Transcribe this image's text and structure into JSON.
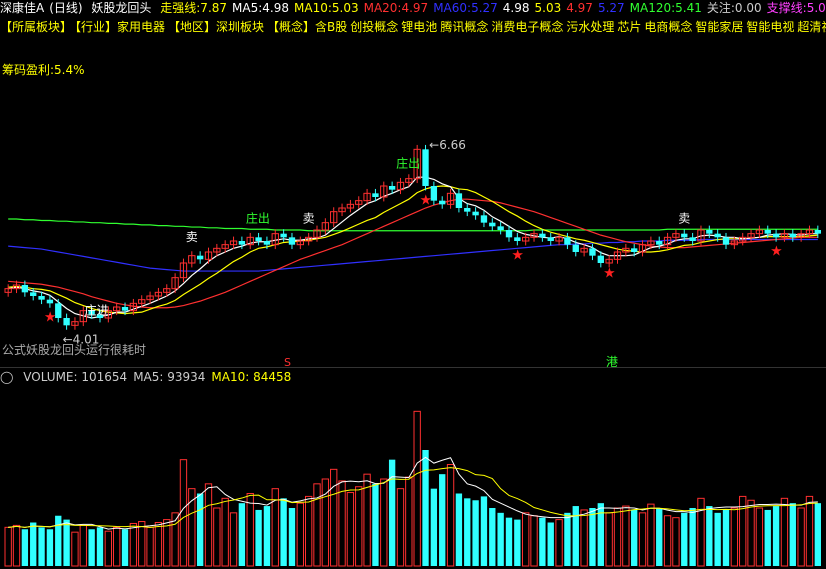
{
  "header": {
    "stock": "深康佳A",
    "period": "(日线)",
    "formula_name": "妖股龙回头",
    "indicators": [
      {
        "label": "走强线:",
        "value": "7.87",
        "color": "#ffff00"
      },
      {
        "label": "MA5:",
        "value": "4.98",
        "color": "#ffffff"
      },
      {
        "label": "MA10:",
        "value": "5.03",
        "color": "#ffff00"
      },
      {
        "label": "MA20:",
        "value": "4.97",
        "color": "#ff3030"
      },
      {
        "label": "MA60:",
        "value": "5.27",
        "color": "#3030ff"
      },
      {
        "label": "",
        "value": "4.98",
        "color": "#ffffff"
      },
      {
        "label": "",
        "value": "5.03",
        "color": "#ffff00"
      },
      {
        "label": "",
        "value": "4.97",
        "color": "#ff3030"
      },
      {
        "label": "",
        "value": "5.27",
        "color": "#3030ff"
      },
      {
        "label": "MA120:",
        "value": "5.41",
        "color": "#30ff30"
      },
      {
        "label": "关注:",
        "value": "0.00",
        "color": "#cccccc"
      },
      {
        "label": "支撑线:",
        "value": "5.0",
        "color": "#ff40ff"
      }
    ]
  },
  "tags": [
    "【所属板块】",
    "【行业】家用电器",
    "【地区】深圳板块",
    "【概念】含B股",
    "创投概念",
    "锂电池",
    "腾讯概念",
    "消费电子概念",
    "污水处理",
    "芯片",
    "电商概念",
    "智能家居",
    "智能电视",
    "超清视频"
  ],
  "chip_profit": "筹码盈利:5.4%",
  "formula_note": "公式妖股龙回头运行很耗时",
  "markers": {
    "high": "6.66",
    "low": "4.01",
    "sell": "卖",
    "zhuangchu": "庄出",
    "zhuangjin": "庄进",
    "s_mark": "S",
    "gang_mark": "港"
  },
  "volume_header": [
    {
      "label": "VOLUME:",
      "value": "101654",
      "color": "#cccccc"
    },
    {
      "label": "MA5:",
      "value": "93934",
      "color": "#cccccc"
    },
    {
      "label": "MA10:",
      "value": "84458",
      "color": "#ffff00"
    }
  ],
  "colors": {
    "up": "#ff3030",
    "down": "#30ffff",
    "ma5": "#ffffff",
    "ma10": "#ffff00",
    "ma20": "#ff3030",
    "ma60": "#3030ff",
    "ma120": "#30ff30",
    "support": "#ff40ff"
  },
  "chart_data": {
    "type": "candlestick",
    "price_range": [
      3.9,
      6.9
    ],
    "close": [
      4.6,
      4.65,
      4.55,
      4.5,
      4.45,
      4.4,
      4.2,
      4.1,
      4.15,
      4.3,
      4.25,
      4.2,
      4.3,
      4.35,
      4.3,
      4.4,
      4.45,
      4.5,
      4.55,
      4.6,
      4.75,
      4.95,
      5.05,
      5.0,
      5.1,
      5.15,
      5.2,
      5.25,
      5.2,
      5.3,
      5.25,
      5.2,
      5.35,
      5.3,
      5.2,
      5.25,
      5.3,
      5.4,
      5.5,
      5.65,
      5.7,
      5.75,
      5.8,
      5.9,
      5.85,
      6.0,
      5.95,
      6.05,
      6.1,
      6.5,
      6.0,
      5.8,
      5.75,
      5.9,
      5.7,
      5.65,
      5.6,
      5.5,
      5.45,
      5.4,
      5.3,
      5.25,
      5.3,
      5.35,
      5.3,
      5.25,
      5.3,
      5.2,
      5.1,
      5.15,
      5.05,
      4.95,
      5.0,
      5.1,
      5.15,
      5.1,
      5.2,
      5.25,
      5.2,
      5.3,
      5.35,
      5.3,
      5.25,
      5.4,
      5.35,
      5.3,
      5.2,
      5.25,
      5.3,
      5.35,
      5.4,
      5.35,
      5.3,
      5.35,
      5.3,
      5.35,
      5.4,
      5.35
    ],
    "volume": [
      40,
      42,
      38,
      45,
      40,
      38,
      52,
      48,
      35,
      42,
      38,
      40,
      36,
      40,
      38,
      44,
      46,
      40,
      45,
      48,
      55,
      110,
      80,
      75,
      85,
      60,
      70,
      55,
      65,
      75,
      58,
      62,
      80,
      70,
      60,
      65,
      72,
      85,
      90,
      100,
      88,
      76,
      82,
      95,
      85,
      90,
      110,
      80,
      92,
      160,
      120,
      80,
      95,
      105,
      75,
      70,
      68,
      72,
      60,
      55,
      50,
      48,
      55,
      52,
      50,
      45,
      48,
      55,
      62,
      58,
      60,
      65,
      55,
      60,
      62,
      58,
      55,
      64,
      60,
      52,
      50,
      55,
      60,
      70,
      62,
      55,
      58,
      60,
      72,
      68,
      60,
      58,
      62,
      70,
      65,
      60,
      72,
      65
    ],
    "ma5": [
      4.6,
      4.62,
      4.6,
      4.57,
      4.55,
      4.51,
      4.42,
      4.33,
      4.26,
      4.23,
      4.2,
      4.22,
      4.24,
      4.28,
      4.28,
      4.32,
      4.36,
      4.4,
      4.45,
      4.5,
      4.57,
      4.67,
      4.78,
      4.87,
      4.97,
      5.05,
      5.1,
      5.15,
      5.18,
      5.22,
      5.24,
      5.24,
      5.26,
      5.28,
      5.26,
      5.26,
      5.28,
      5.29,
      5.33,
      5.42,
      5.51,
      5.6,
      5.68,
      5.76,
      5.8,
      5.86,
      5.9,
      5.95,
      5.99,
      6.12,
      6.12,
      6.09,
      6.03,
      5.99,
      5.83,
      5.76,
      5.73,
      5.67,
      5.58,
      5.52,
      5.45,
      5.38,
      5.34,
      5.32,
      5.3,
      5.29,
      5.31,
      5.28,
      5.23,
      5.2,
      5.16,
      5.09,
      5.05,
      5.05,
      5.05,
      5.06,
      5.11,
      5.16,
      5.18,
      5.21,
      5.26,
      5.28,
      5.28,
      5.32,
      5.33,
      5.32,
      5.3,
      5.3,
      5.28,
      5.29,
      5.3,
      5.33,
      5.34,
      5.35,
      5.34,
      5.33,
      5.35,
      5.35
    ],
    "ma10": [
      4.62,
      4.63,
      4.62,
      4.6,
      4.59,
      4.57,
      4.52,
      4.47,
      4.41,
      4.37,
      4.33,
      4.3,
      4.28,
      4.27,
      4.26,
      4.27,
      4.28,
      4.32,
      4.36,
      4.39,
      4.44,
      4.52,
      4.59,
      4.66,
      4.74,
      4.81,
      4.89,
      4.97,
      5.03,
      5.1,
      5.15,
      5.17,
      5.2,
      5.23,
      5.24,
      5.25,
      5.26,
      5.28,
      5.3,
      5.34,
      5.38,
      5.43,
      5.48,
      5.53,
      5.57,
      5.64,
      5.7,
      5.76,
      5.82,
      5.91,
      5.96,
      5.99,
      6.0,
      5.99,
      5.96,
      5.95,
      5.91,
      5.85,
      5.79,
      5.72,
      5.65,
      5.59,
      5.52,
      5.46,
      5.41,
      5.37,
      5.34,
      5.31,
      5.28,
      5.26,
      5.23,
      5.2,
      5.17,
      5.14,
      5.12,
      5.11,
      5.1,
      5.1,
      5.11,
      5.13,
      5.16,
      5.19,
      5.2,
      5.23,
      5.25,
      5.27,
      5.28,
      5.28,
      5.28,
      5.29,
      5.3,
      5.31,
      5.31,
      5.31,
      5.31,
      5.31,
      5.32,
      5.33
    ],
    "ma20": [
      4.7,
      4.69,
      4.68,
      4.67,
      4.66,
      4.64,
      4.62,
      4.59,
      4.56,
      4.53,
      4.49,
      4.46,
      4.43,
      4.4,
      4.38,
      4.36,
      4.35,
      4.34,
      4.34,
      4.34,
      4.35,
      4.37,
      4.4,
      4.43,
      4.47,
      4.51,
      4.55,
      4.6,
      4.65,
      4.7,
      4.75,
      4.8,
      4.85,
      4.9,
      4.95,
      5.0,
      5.04,
      5.08,
      5.12,
      5.16,
      5.2,
      5.25,
      5.3,
      5.35,
      5.4,
      5.45,
      5.5,
      5.55,
      5.6,
      5.65,
      5.7,
      5.74,
      5.77,
      5.8,
      5.82,
      5.82,
      5.81,
      5.8,
      5.79,
      5.77,
      5.74,
      5.71,
      5.68,
      5.65,
      5.61,
      5.57,
      5.53,
      5.49,
      5.45,
      5.41,
      5.37,
      5.33,
      5.3,
      5.27,
      5.24,
      5.22,
      5.2,
      5.18,
      5.17,
      5.16,
      5.16,
      5.16,
      5.17,
      5.18,
      5.19,
      5.2,
      5.21,
      5.22,
      5.23,
      5.24,
      5.25,
      5.26,
      5.27,
      5.28,
      5.29,
      5.3,
      5.3,
      5.3
    ],
    "ma60": [
      5.18,
      5.17,
      5.16,
      5.15,
      5.14,
      5.12,
      5.1,
      5.08,
      5.06,
      5.04,
      5.02,
      5.0,
      4.98,
      4.96,
      4.94,
      4.92,
      4.9,
      4.88,
      4.87,
      4.86,
      4.85,
      4.84,
      4.84,
      4.84,
      4.84,
      4.84,
      4.84,
      4.84,
      4.84,
      4.84,
      4.84,
      4.85,
      4.86,
      4.87,
      4.88,
      4.89,
      4.9,
      4.91,
      4.92,
      4.93,
      4.94,
      4.95,
      4.96,
      4.97,
      4.98,
      4.99,
      5.0,
      5.01,
      5.02,
      5.03,
      5.04,
      5.05,
      5.06,
      5.07,
      5.08,
      5.09,
      5.1,
      5.11,
      5.12,
      5.13,
      5.14,
      5.15,
      5.16,
      5.17,
      5.18,
      5.19,
      5.2,
      5.2,
      5.21,
      5.21,
      5.22,
      5.22,
      5.23,
      5.23,
      5.24,
      5.24,
      5.25,
      5.25,
      5.25,
      5.26,
      5.26,
      5.26,
      5.26,
      5.27,
      5.27,
      5.27,
      5.27,
      5.27,
      5.27,
      5.27,
      5.27,
      5.27,
      5.27,
      5.27,
      5.27,
      5.27,
      5.27,
      5.27
    ],
    "ma120": [
      5.55,
      5.55,
      5.54,
      5.54,
      5.53,
      5.53,
      5.52,
      5.52,
      5.51,
      5.51,
      5.5,
      5.5,
      5.49,
      5.49,
      5.48,
      5.48,
      5.47,
      5.47,
      5.46,
      5.46,
      5.45,
      5.45,
      5.44,
      5.44,
      5.43,
      5.43,
      5.42,
      5.42,
      5.42,
      5.41,
      5.41,
      5.41,
      5.4,
      5.4,
      5.4,
      5.4,
      5.39,
      5.39,
      5.39,
      5.39,
      5.39,
      5.39,
      5.39,
      5.39,
      5.39,
      5.39,
      5.39,
      5.39,
      5.39,
      5.39,
      5.39,
      5.39,
      5.39,
      5.39,
      5.39,
      5.39,
      5.39,
      5.39,
      5.39,
      5.39,
      5.39,
      5.39,
      5.39,
      5.4,
      5.4,
      5.4,
      5.4,
      5.4,
      5.4,
      5.4,
      5.4,
      5.4,
      5.4,
      5.4,
      5.4,
      5.4,
      5.4,
      5.4,
      5.4,
      5.41,
      5.41,
      5.41,
      5.41,
      5.41,
      5.41,
      5.41,
      5.41,
      5.41,
      5.41,
      5.41,
      5.41,
      5.41,
      5.41,
      5.41,
      5.41,
      5.41,
      5.41,
      5.41
    ],
    "volume_range": [
      0,
      180
    ]
  }
}
